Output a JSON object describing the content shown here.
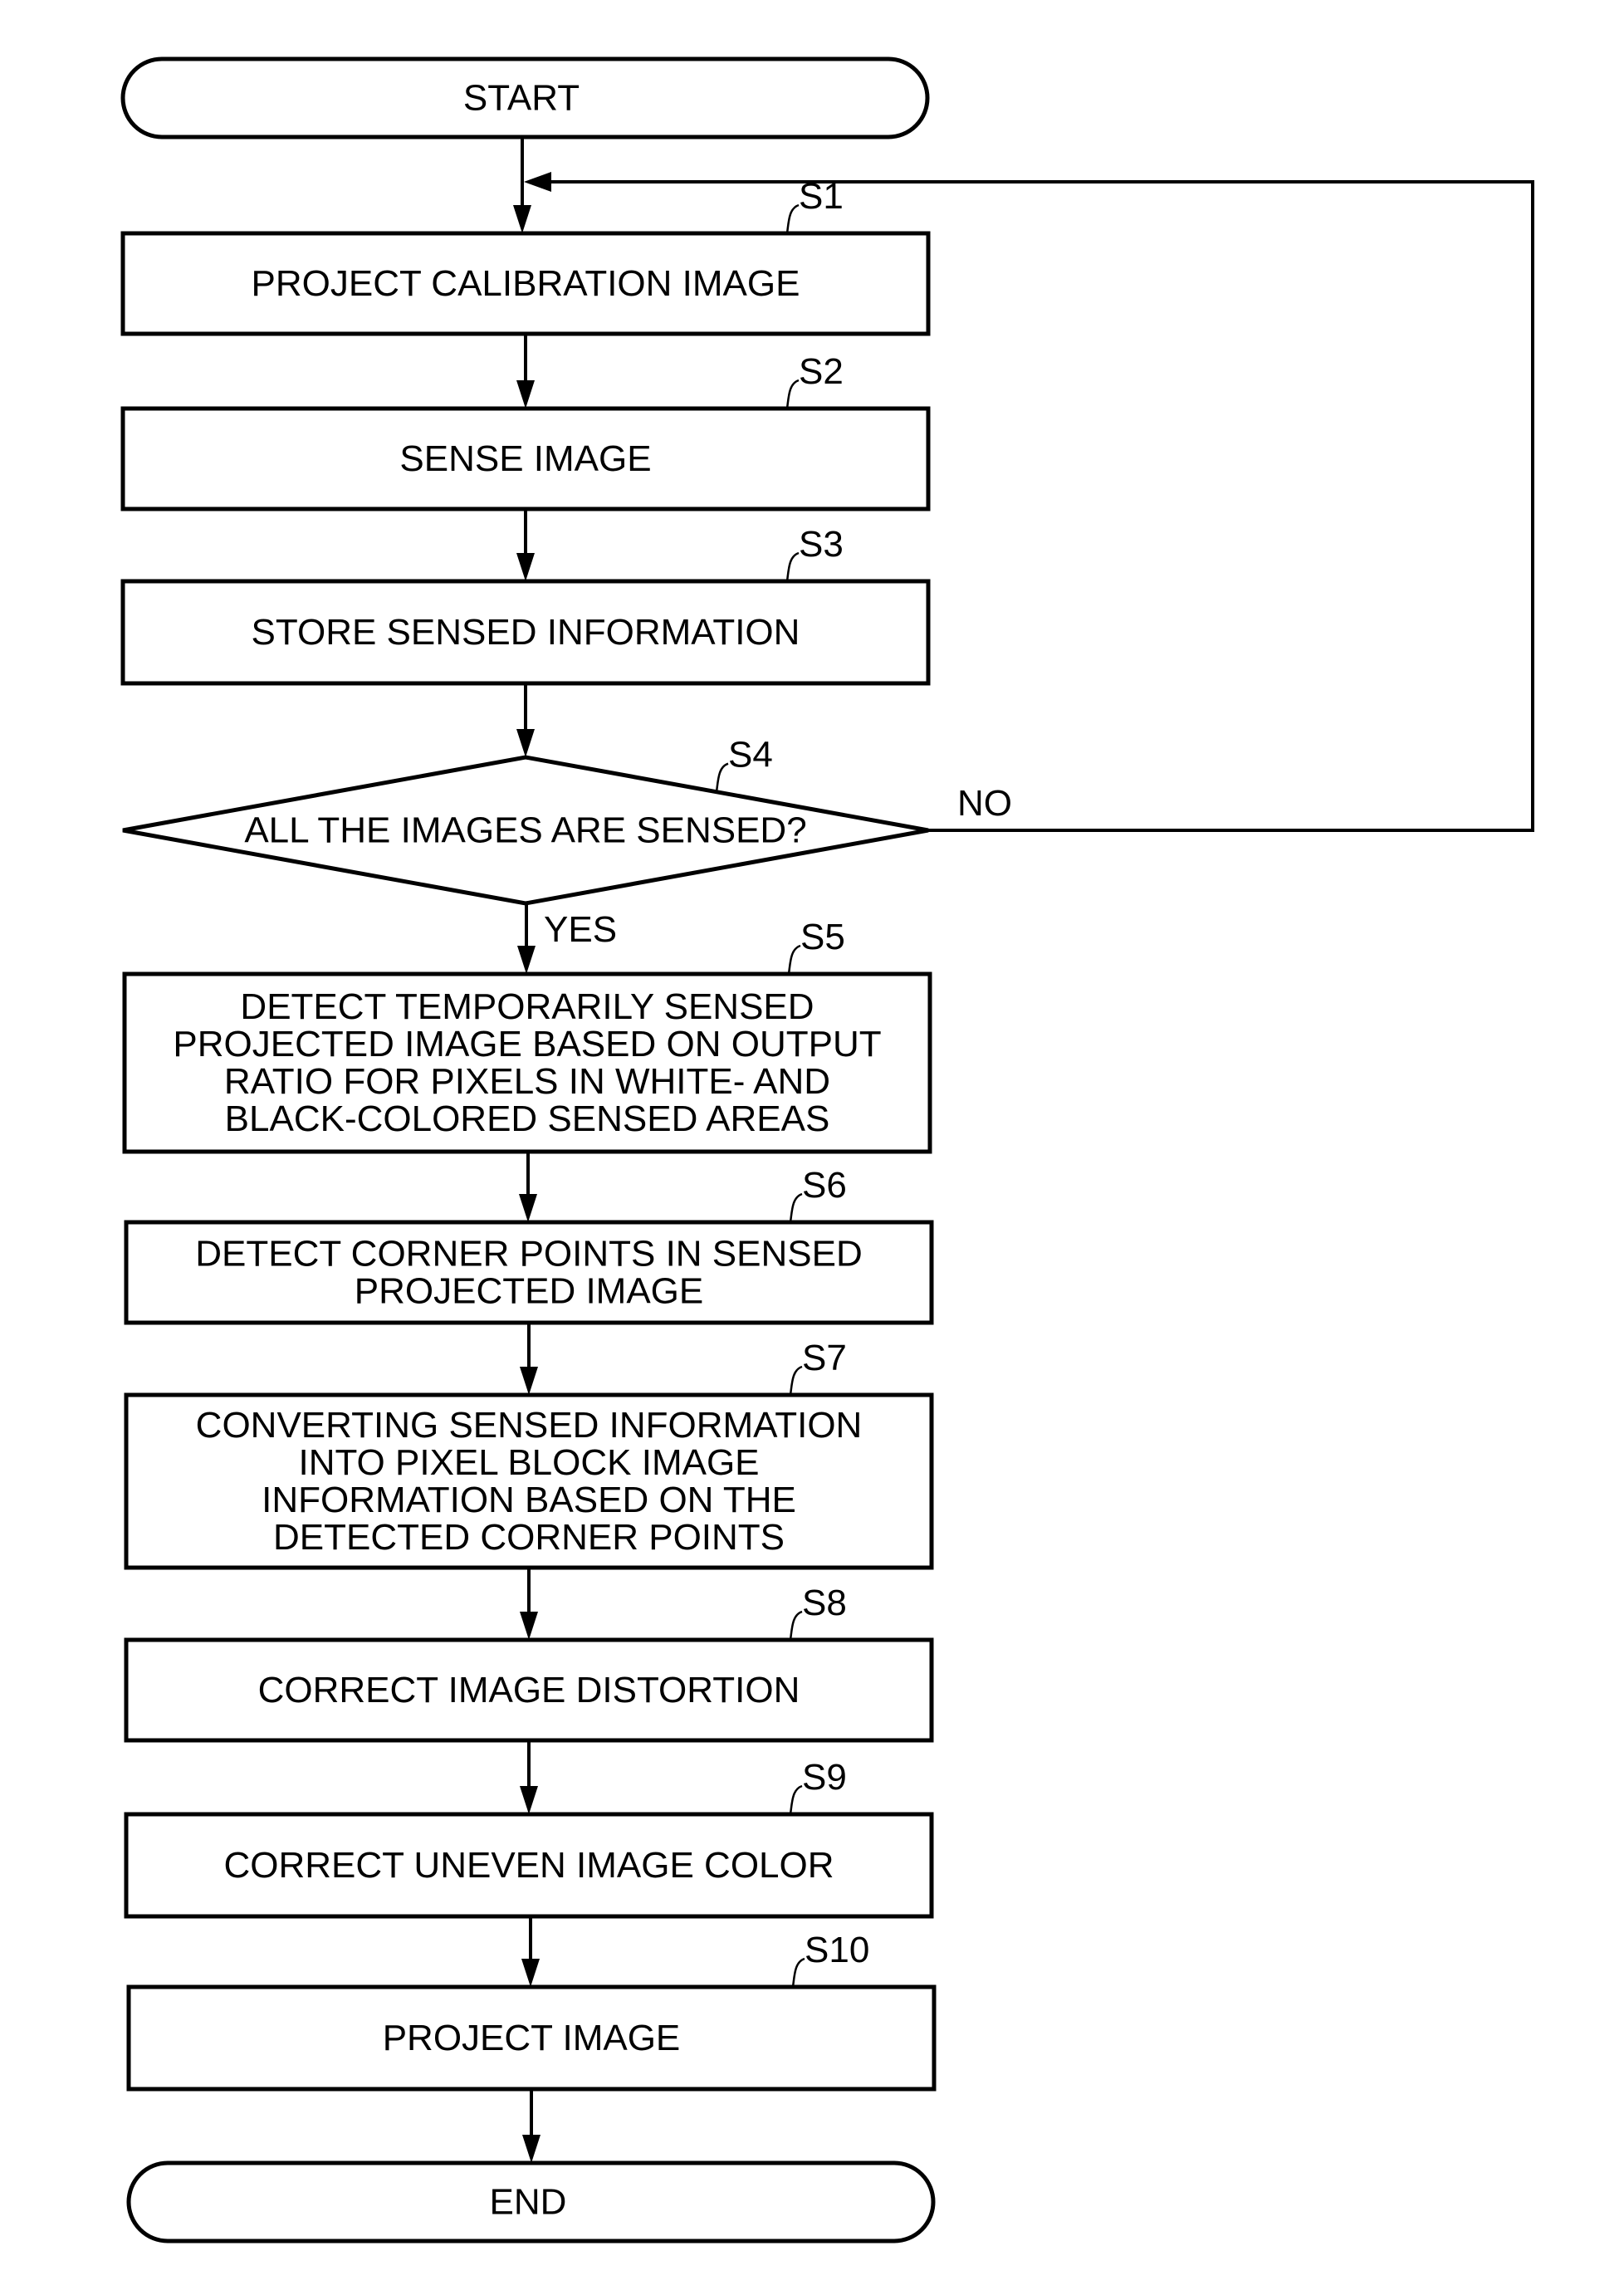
{
  "diagram": {
    "type": "flowchart",
    "colors": {
      "line": "#000000",
      "background": "#ffffff"
    },
    "start": {
      "label": "START"
    },
    "end": {
      "label": "END"
    },
    "steps": [
      {
        "id": "S1",
        "kind": "process",
        "lines": [
          "PROJECT CALIBRATION IMAGE"
        ]
      },
      {
        "id": "S2",
        "kind": "process",
        "lines": [
          "SENSE IMAGE"
        ]
      },
      {
        "id": "S3",
        "kind": "process",
        "lines": [
          "STORE SENSED INFORMATION"
        ]
      },
      {
        "id": "S4",
        "kind": "decision",
        "lines": [
          "ALL THE IMAGES ARE SENSED?"
        ],
        "yes_label": "YES",
        "no_label": "NO",
        "no_target": "S1"
      },
      {
        "id": "S5",
        "kind": "process",
        "lines": [
          "DETECT TEMPORARILY SENSED",
          "PROJECTED IMAGE BASED ON  OUTPUT",
          "RATIO FOR PIXELS IN WHITE- AND",
          "BLACK-COLORED SENSED AREAS"
        ]
      },
      {
        "id": "S6",
        "kind": "process",
        "lines": [
          "DETECT CORNER POINTS IN SENSED",
          "PROJECTED IMAGE"
        ]
      },
      {
        "id": "S7",
        "kind": "process",
        "lines": [
          "CONVERTING SENSED INFORMATION",
          "INTO PIXEL BLOCK IMAGE",
          "INFORMATION BASED ON THE",
          "DETECTED CORNER POINTS"
        ]
      },
      {
        "id": "S8",
        "kind": "process",
        "lines": [
          "CORRECT IMAGE DISTORTION"
        ]
      },
      {
        "id": "S9",
        "kind": "process",
        "lines": [
          "CORRECT UNEVEN IMAGE COLOR"
        ]
      },
      {
        "id": "S10",
        "kind": "process",
        "lines": [
          "PROJECT IMAGE"
        ]
      }
    ]
  }
}
